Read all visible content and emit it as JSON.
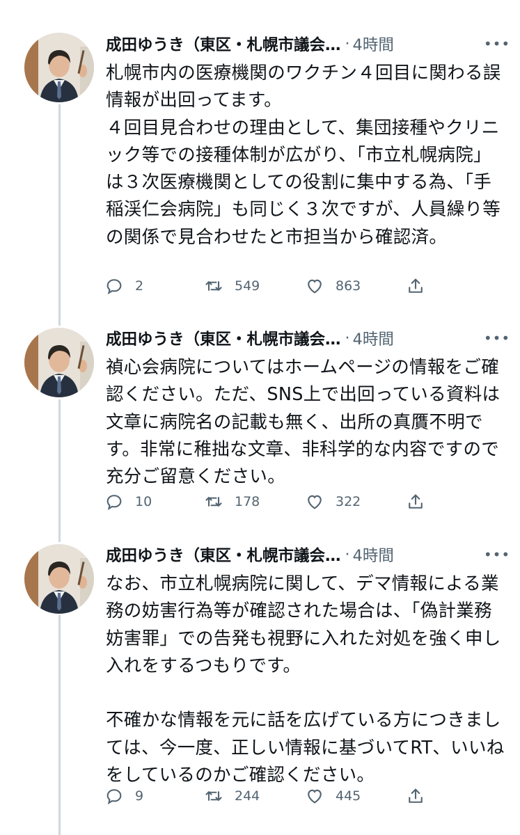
{
  "tweets": [
    {
      "author": "成田ゆうき（東区・札幌市議会…",
      "time": "4時間",
      "text": "札幌市内の医療機関のワクチン４回目に関わる誤情報が出回ってます。\n４回目見合わせの理由として、集団接種やクリニック等での接種体制が広がり、「市立札幌病院」は３次医療機関としての役割に集中する為、「手稲渓仁会病院」も同じく３次ですが、人員繰り等の関係で見合わせたと市担当から確認済。",
      "replies": "2",
      "retweets": "549",
      "likes": "863"
    },
    {
      "author": "成田ゆうき（東区・札幌市議会…",
      "time": "4時間",
      "text": "禎心会病院についてはホームページの情報をご確認ください。ただ、SNS上で出回っている資料は文章に病院名の記載も無く、出所の真贋不明です。非常に稚拙な文章、非科学的な内容ですので充分ご留意ください。",
      "replies": "10",
      "retweets": "178",
      "likes": "322"
    },
    {
      "author": "成田ゆうき（東区・札幌市議会…",
      "time": "4時間",
      "text": "なお、市立札幌病院に関して、デマ情報による業務の妨害行為等が確認された場合は、「偽計業務妨害罪」での告発も視野に入れた対処を強く申し入れをするつもりです。\n\n不確かな情報を元に話を広げている方につきましては、今一度、正しい情報に基づいてRT、いいねをしているのかご確認ください。",
      "replies": "9",
      "retweets": "244",
      "likes": "445"
    }
  ],
  "icons": {
    "more": "more-icon",
    "reply": "reply-icon",
    "retweet": "retweet-icon",
    "like": "like-icon",
    "share": "share-icon"
  },
  "colors": {
    "text": "#0f1419",
    "secondary": "#536471",
    "thread_line": "#cfd9de"
  }
}
